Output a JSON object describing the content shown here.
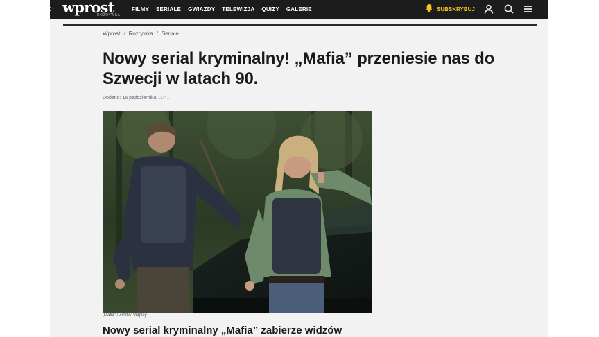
{
  "header": {
    "back_glyph": "‹",
    "logo": "wprost",
    "logo_sub": "ROZRYWKA",
    "nav": [
      "FILMY",
      "SERIALE",
      "GWIAZDY",
      "TELEWIZJA",
      "QUIZY",
      "GALERIE"
    ],
    "subscribe_label": "SUBSKRYBUJ",
    "accent_color": "#f5c518",
    "icons": [
      "bell-icon",
      "user-icon",
      "search-icon",
      "menu-icon"
    ]
  },
  "breadcrumb": [
    "Wprost",
    "Rozrywka",
    "Seriale"
  ],
  "article": {
    "title": "Nowy serial kryminalny! „Mafia” przeniesie nas do Szwecji w latach 90.",
    "added_label": "Dodano:",
    "date": "16 października",
    "time": "11:41",
    "photo_caption": "„Mafia” / Źródło: Viaplay",
    "lead": "Nowy serial kryminalny „Mafia” zabierze widzów"
  }
}
